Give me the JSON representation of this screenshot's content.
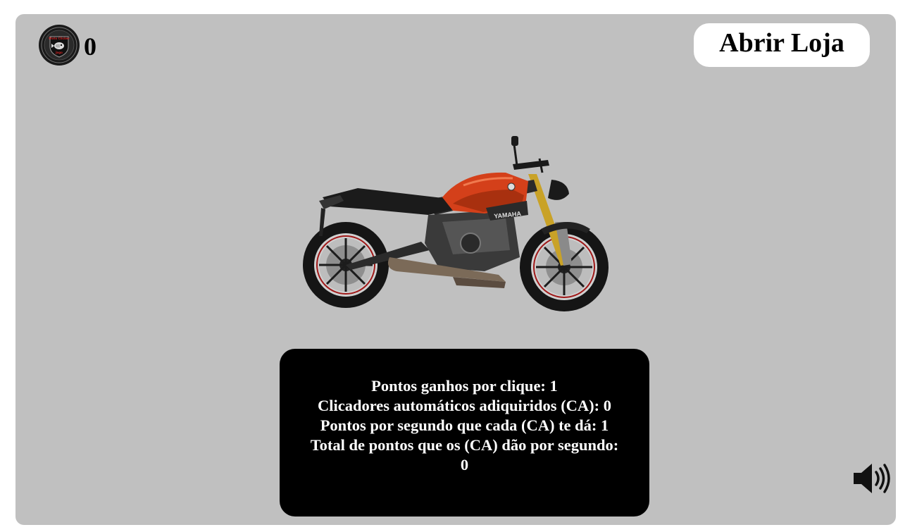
{
  "score": "0",
  "shop": {
    "label": "Abrir Loja"
  },
  "badge": {
    "top_text": "Moto Clicker",
    "bottom_text": "Jogo"
  },
  "bike": {
    "brand": "YAMAHA"
  },
  "stats": {
    "per_click": "Pontos ganhos por clique: 1",
    "auto_clickers": "Clicadores automáticos adiquiridos (CA): 0",
    "per_second_each": "Pontos por segundo que cada (CA) te dá: 1",
    "total_label": "Total de pontos que os (CA) dão por segundo:",
    "total_value": "0"
  },
  "colors": {
    "background": "#c0c0c0",
    "stats_panel": "#000000",
    "shop_button": "#ffffff",
    "bike_tank": "#d4401a"
  },
  "icons": {
    "sound": "volume-icon",
    "badge": "club-badge-icon"
  }
}
